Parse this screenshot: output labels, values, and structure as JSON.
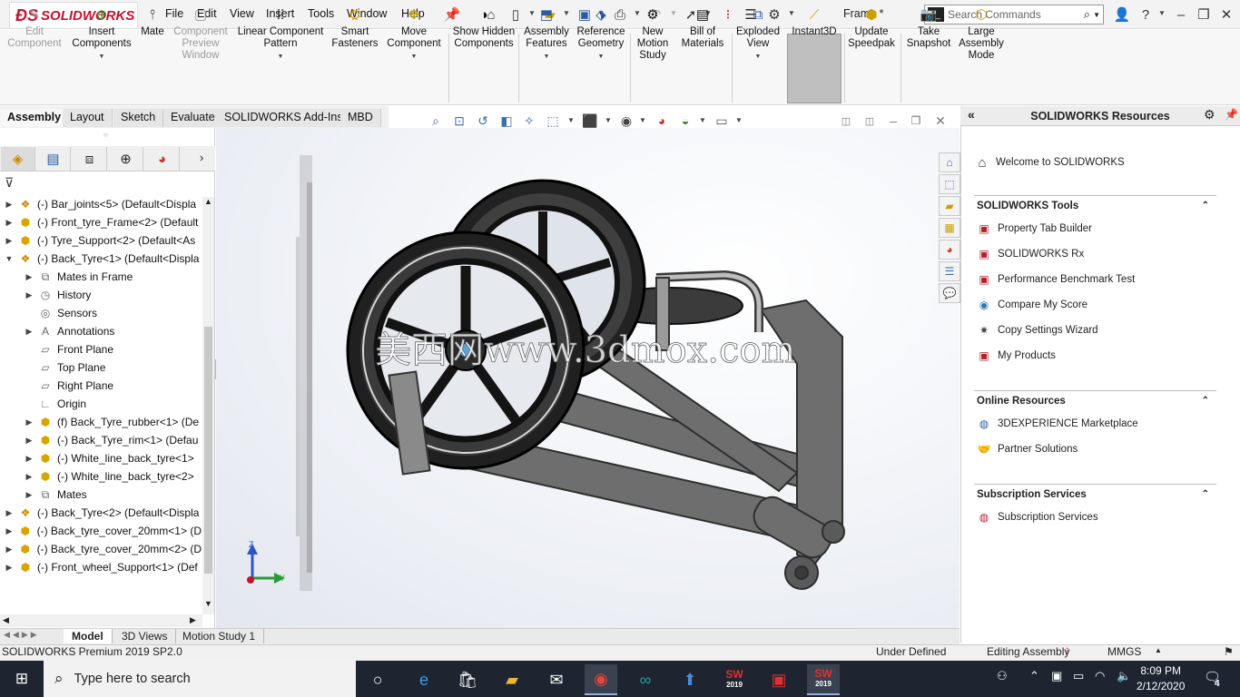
{
  "app": {
    "brand": "SOLIDWORKS",
    "document_title": "Frame *",
    "search_placeholder": "Search Commands"
  },
  "menu": [
    "File",
    "Edit",
    "View",
    "Insert",
    "Tools",
    "Window",
    "Help"
  ],
  "commands": [
    {
      "label": "Edit Component",
      "icon": "edit-component-icon",
      "disabled": true
    },
    {
      "label": "Insert Components",
      "icon": "insert-components-icon",
      "disabled": false
    },
    {
      "label": "Mate",
      "icon": "paperclip-icon",
      "disabled": false
    },
    {
      "label": "Component Preview Window",
      "icon": "preview-window-icon",
      "disabled": true
    },
    {
      "label": "Linear Component Pattern",
      "icon": "pattern-icon",
      "disabled": false
    },
    {
      "label": "Smart Fasteners",
      "icon": "fastener-icon",
      "disabled": false
    },
    {
      "label": "Move Component",
      "icon": "move-icon",
      "disabled": false
    },
    {
      "label": "Show Hidden Components",
      "icon": "show-hidden-icon",
      "disabled": false
    },
    {
      "label": "Assembly Features",
      "icon": "assembly-features-icon",
      "disabled": false
    },
    {
      "label": "Reference Geometry",
      "icon": "reference-geometry-icon",
      "disabled": false
    },
    {
      "label": "New Motion Study",
      "icon": "motion-study-icon",
      "disabled": false
    },
    {
      "label": "Bill of Materials",
      "icon": "bom-icon",
      "disabled": false
    },
    {
      "label": "Exploded View",
      "icon": "exploded-view-icon",
      "disabled": false
    },
    {
      "label": "Instant3D",
      "icon": "instant3d-icon",
      "disabled": false
    },
    {
      "label": "Update Speedpak",
      "icon": "speedpak-icon",
      "disabled": false
    },
    {
      "label": "Take Snapshot",
      "icon": "camera-icon",
      "disabled": false
    },
    {
      "label": "Large Assembly Mode",
      "icon": "large-assembly-icon",
      "disabled": false
    }
  ],
  "tabs": [
    "Assembly",
    "Layout",
    "Sketch",
    "Evaluate",
    "SOLIDWORKS Add-Ins",
    "MBD"
  ],
  "feature_tree": [
    {
      "label": "(-) Bar_joints<5> (Default<Displa",
      "level": 0,
      "expander": "▶",
      "icon": "assembly-icon"
    },
    {
      "label": "(-) Front_tyre_Frame<2> (Default",
      "level": 0,
      "expander": "▶",
      "icon": "part-icon"
    },
    {
      "label": "(-) Tyre_Support<2> (Default<As",
      "level": 0,
      "expander": "▶",
      "icon": "part-icon"
    },
    {
      "label": "(-) Back_Tyre<1> (Default<Displa",
      "level": 0,
      "expander": "▼",
      "icon": "assembly-icon"
    },
    {
      "label": "Mates in Frame",
      "level": 1,
      "expander": "▶",
      "icon": "mates-icon"
    },
    {
      "label": "History",
      "level": 1,
      "expander": "▶",
      "icon": "history-icon"
    },
    {
      "label": "Sensors",
      "level": 1,
      "expander": "",
      "icon": "sensor-icon"
    },
    {
      "label": "Annotations",
      "level": 1,
      "expander": "▶",
      "icon": "annotation-icon"
    },
    {
      "label": "Front Plane",
      "level": 1,
      "expander": "",
      "icon": "plane-icon"
    },
    {
      "label": "Top Plane",
      "level": 1,
      "expander": "",
      "icon": "plane-icon"
    },
    {
      "label": "Right Plane",
      "level": 1,
      "expander": "",
      "icon": "plane-icon"
    },
    {
      "label": "Origin",
      "level": 1,
      "expander": "",
      "icon": "origin-icon"
    },
    {
      "label": "(f) Back_Tyre_rubber<1> (De",
      "level": 1,
      "expander": "▶",
      "icon": "part-icon"
    },
    {
      "label": "(-) Back_Tyre_rim<1> (Defau",
      "level": 1,
      "expander": "▶",
      "icon": "part-icon"
    },
    {
      "label": "(-) White_line_back_tyre<1>",
      "level": 1,
      "expander": "▶",
      "icon": "part-icon"
    },
    {
      "label": "(-) White_line_back_tyre<2>",
      "level": 1,
      "expander": "▶",
      "icon": "part-icon"
    },
    {
      "label": "Mates",
      "level": 1,
      "expander": "▶",
      "icon": "mates-icon"
    },
    {
      "label": "(-) Back_Tyre<2> (Default<Displa",
      "level": 0,
      "expander": "▶",
      "icon": "assembly-icon"
    },
    {
      "label": "(-) Back_tyre_cover_20mm<1> (D",
      "level": 0,
      "expander": "▶",
      "icon": "part-icon"
    },
    {
      "label": "(-) Back_tyre_cover_20mm<2> (D",
      "level": 0,
      "expander": "▶",
      "icon": "part-icon"
    },
    {
      "label": "(-) Front_wheel_Support<1> (Def",
      "level": 0,
      "expander": "▶",
      "icon": "part-icon"
    }
  ],
  "bottom_tabs": [
    "Model",
    "3D Views",
    "Motion Study 1"
  ],
  "viewport": {
    "watermark": "美西网www.3dmox.com",
    "triad": {
      "z": "Z",
      "y": "Y"
    }
  },
  "resources": {
    "title": "SOLIDWORKS Resources",
    "welcome": "Welcome to SOLIDWORKS",
    "sections": [
      {
        "title": "SOLIDWORKS Tools",
        "items": [
          "Property Tab Builder",
          "SOLIDWORKS Rx",
          "Performance Benchmark Test",
          "Compare My Score",
          "Copy Settings Wizard",
          "My Products"
        ]
      },
      {
        "title": "Online Resources",
        "items": [
          "3DEXPERIENCE Marketplace",
          "Partner Solutions"
        ]
      },
      {
        "title": "Subscription Services",
        "items": [
          "Subscription Services"
        ]
      }
    ]
  },
  "status": {
    "product": "SOLIDWORKS Premium 2019 SP2.0",
    "state": "Under Defined",
    "mode": "Editing Assembly",
    "units": "MMGS"
  },
  "taskbar": {
    "search_placeholder": "Type here to search",
    "time": "8:09 PM",
    "date": "2/12/2020",
    "notifications": "4",
    "sw_badge": "2019"
  },
  "colors": {
    "accent": "#c8102e",
    "selected_command_bg": "#bfbfbf",
    "taskbar": "#1e2530"
  }
}
